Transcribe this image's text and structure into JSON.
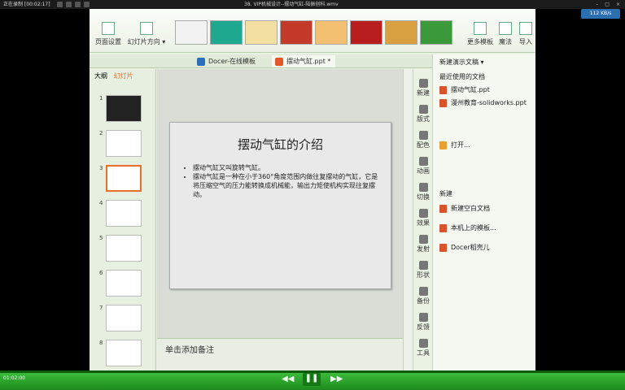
{
  "recorder": {
    "status": "正在录制 [00:02:17]",
    "window_title": "38. VIP机械设计--摆动气缸-陆振创科.wmv"
  },
  "ribbon": {
    "page_setup": "页面设置",
    "slide_orientation": "幻灯片方向 ▾",
    "more_templates": "更多模板",
    "magic": "魔法",
    "import": "导入"
  },
  "tabs": [
    {
      "label": "Docer-在线模板"
    },
    {
      "label": "摆动气缸.ppt *"
    }
  ],
  "left_pane": {
    "tab_outline": "大纲",
    "tab_slides": "幻灯片",
    "slide_numbers": [
      "1",
      "2",
      "3",
      "4",
      "5",
      "6",
      "7",
      "8"
    ]
  },
  "slide": {
    "title": "摆动气缸的介绍",
    "bullets": [
      "摆动气缸又叫旋转气缸。",
      "摆动气缸是一种在小于360°角度范围内做往复摆动的气缸，它是将压缩空气的压力能转换成机械能，输出力矩使机构实现往复摆动。"
    ]
  },
  "notes": {
    "placeholder": "单击添加备注"
  },
  "side_icons": [
    "新建",
    "版式",
    "配色",
    "动画",
    "切换",
    "效果",
    "发射",
    "形状",
    "备份",
    "反馈",
    "工具"
  ],
  "task_pane": {
    "title": "新建演示文稿 ▾",
    "recent_heading": "最近使用的文档",
    "recent_files": [
      "摆动气缸.ppt",
      "漫州教育-solidworks.ppt"
    ],
    "open": "打开...",
    "new_heading": "新建",
    "new_items": [
      "新建空白文档",
      "本机上的模板...",
      "Docer稻壳儿"
    ]
  },
  "player": {
    "time": "01:02:00",
    "network": "112 KB/s"
  },
  "colors": {
    "ribbon_green": "#eaf2e4",
    "player_green": "#2fae2f",
    "accent_orange": "#e8702a"
  }
}
